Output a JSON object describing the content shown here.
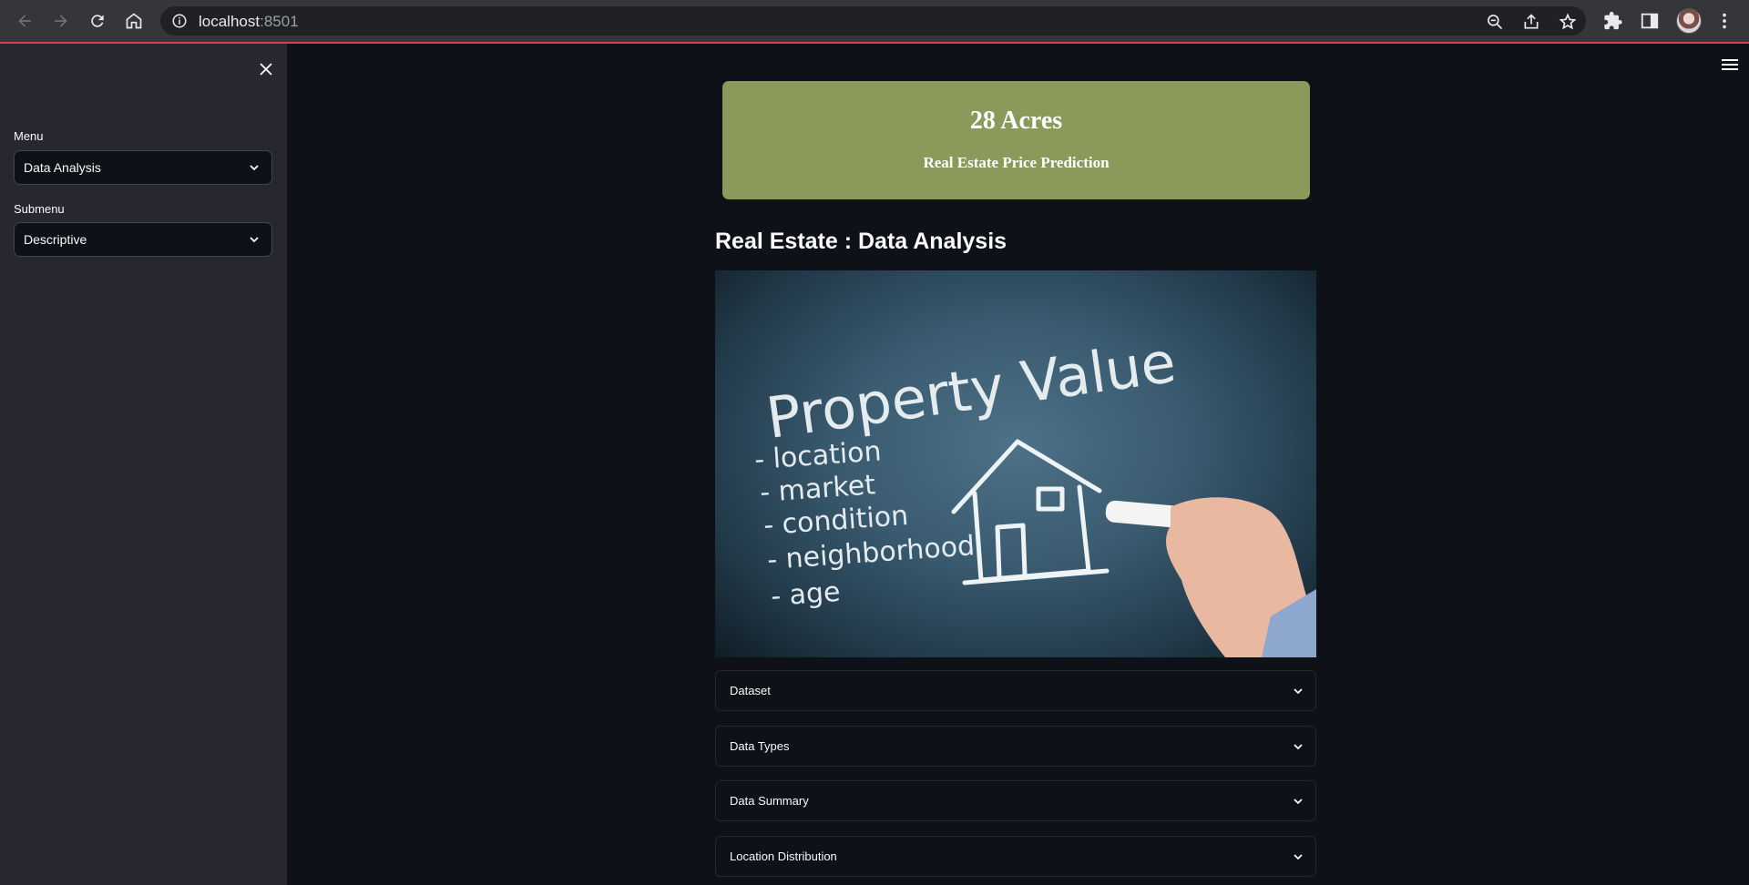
{
  "browser": {
    "url_host": "localhost",
    "url_port": ":8501",
    "icons": [
      "back-arrow-icon",
      "forward-arrow-icon",
      "reload-icon",
      "home-icon",
      "info-icon",
      "zoom-icon",
      "share-icon",
      "star-icon",
      "extensions-icon",
      "side-panel-icon",
      "avatar",
      "kebab-menu-icon"
    ]
  },
  "sidebar": {
    "menu_label": "Menu",
    "menu_value": "Data Analysis",
    "submenu_label": "Submenu",
    "submenu_value": "Descriptive"
  },
  "banner": {
    "title": "28 Acres",
    "subtitle": "Real Estate Price Prediction",
    "bg_color": "#8a9a5b"
  },
  "main": {
    "title": "Real Estate : Data Analysis"
  },
  "hero_image": {
    "heading": "Property Value",
    "items": [
      "- location",
      "- market",
      "- condition",
      "- neighborhood",
      "- age"
    ]
  },
  "expanders": [
    {
      "label": "Dataset"
    },
    {
      "label": "Data Types"
    },
    {
      "label": "Data Summary"
    },
    {
      "label": "Location Distribution"
    }
  ],
  "colors": {
    "app_bg": "#0e1117",
    "sidebar_bg": "#262730",
    "accent": "#ff4b4b"
  }
}
